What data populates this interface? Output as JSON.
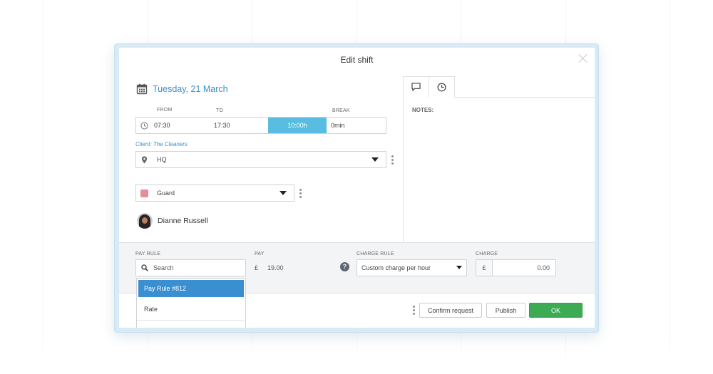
{
  "modal": {
    "title": "Edit shift"
  },
  "shift": {
    "date": "Tuesday, 21 March",
    "labels": {
      "from": "FROM",
      "to": "TO",
      "break": "BREAK"
    },
    "from": "07:30",
    "to": "17:30",
    "duration": "10:00h",
    "break": "0min"
  },
  "client": {
    "label": "Client: The Cleaners"
  },
  "location": {
    "value": "HQ"
  },
  "position": {
    "value": "Guard",
    "color": "#e48c97"
  },
  "employee": {
    "name": "Dianne Russell"
  },
  "notes": {
    "label": "NOTES:"
  },
  "pay": {
    "pay_rule_label": "PAY RULE",
    "search_placeholder": "Search",
    "pay_label": "PAY",
    "currency": "£",
    "pay_value": "19.00",
    "charge_rule_label": "CHARGE RULE",
    "charge_rule_value": "Custom charge per hour",
    "charge_label": "CHARGE",
    "charge_value": "0.00"
  },
  "dropdown": {
    "items": [
      "Pay Rule #812",
      "Rate"
    ]
  },
  "footer": {
    "confirm_label": "Confirm request",
    "publish_label": "Publish",
    "ok_label": "OK"
  },
  "colors": {
    "accent": "#3a8fc8",
    "duration": "#58bde0",
    "ok": "#3daa54",
    "selected": "#3a8fd1"
  },
  "icons": [
    "calendar-icon",
    "clock-icon",
    "location-pin-icon",
    "comment-icon",
    "history-icon",
    "search-icon",
    "help-icon",
    "close-icon",
    "kebab-menu-icon"
  ]
}
